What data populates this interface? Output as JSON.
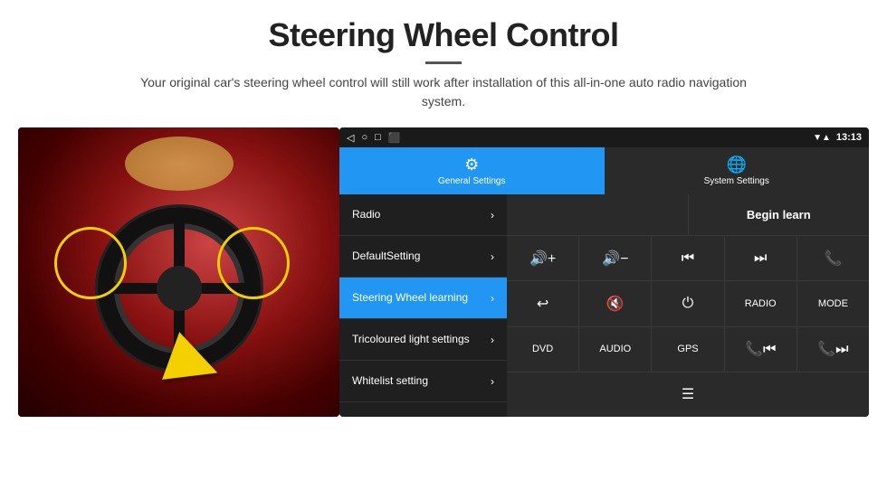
{
  "header": {
    "title": "Steering Wheel Control",
    "subtitle": "Your original car's steering wheel control will still work after installation of this all-in-one auto radio navigation system."
  },
  "status_bar": {
    "time": "13:13",
    "icons": [
      "◁",
      "○",
      "□",
      "⬛"
    ]
  },
  "tabs": [
    {
      "id": "general",
      "label": "General Settings",
      "active": true,
      "icon": "⚙"
    },
    {
      "id": "system",
      "label": "System Settings",
      "active": false,
      "icon": "🌐"
    }
  ],
  "menu_items": [
    {
      "id": "radio",
      "label": "Radio",
      "selected": false
    },
    {
      "id": "default-setting",
      "label": "DefaultSetting",
      "selected": false
    },
    {
      "id": "steering-wheel-learning",
      "label": "Steering Wheel learning",
      "selected": true
    },
    {
      "id": "tricoloured-light",
      "label": "Tricoloured light settings",
      "selected": false
    },
    {
      "id": "whitelist-setting",
      "label": "Whitelist setting",
      "selected": false
    }
  ],
  "controls": {
    "begin_learn": "Begin learn",
    "row1": [
      "🔊+",
      "🔊−",
      "⏮",
      "⏭",
      "📞"
    ],
    "row2": [
      "↩",
      "🔊×",
      "⏻",
      "RADIO",
      "MODE"
    ],
    "row3": [
      "DVD",
      "AUDIO",
      "GPS",
      "📞⏮",
      "📞⏭"
    ],
    "row4_icon": "☰"
  }
}
